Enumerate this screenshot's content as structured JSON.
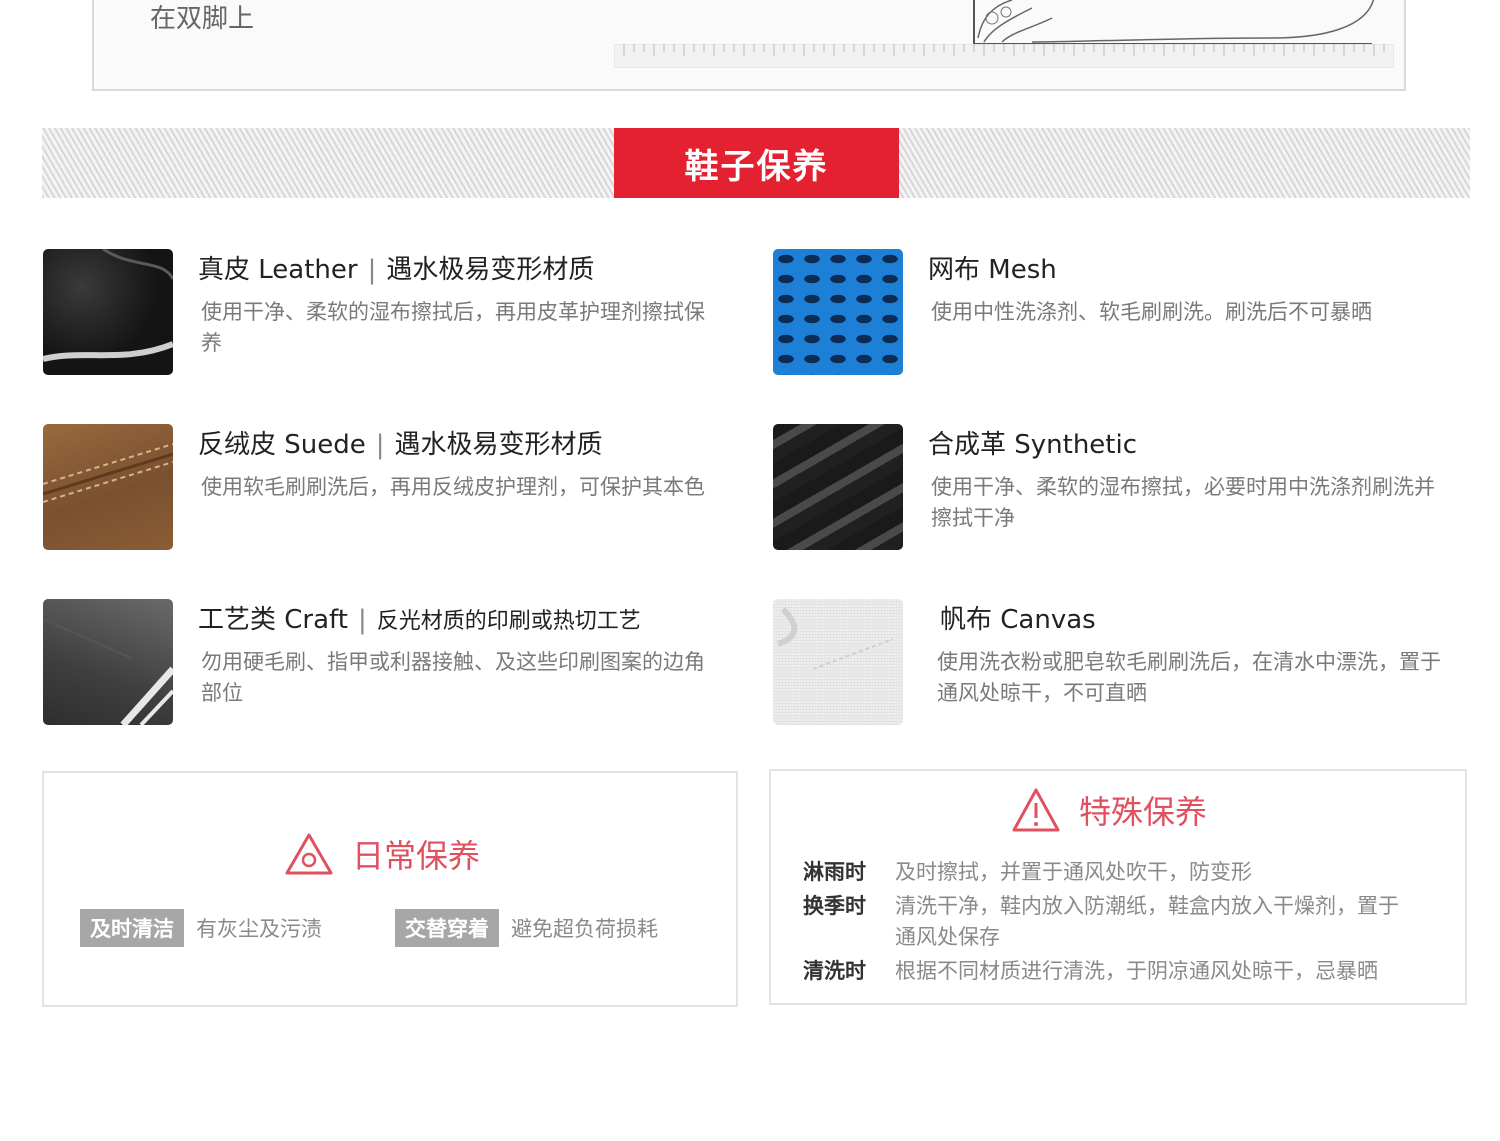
{
  "top_text": "在双脚上",
  "section_title": "鞋子保养",
  "materials": [
    {
      "name": "真皮 Leather",
      "note": "遇水极易变形材质",
      "desc": "使用干净、柔软的湿布擦拭后，再用皮革护理剂擦拭保养"
    },
    {
      "name": "网布 Mesh",
      "note": "",
      "desc": "使用中性洗涤剂、软毛刷刷洗。刷洗后不可暴晒"
    },
    {
      "name": "反绒皮 Suede",
      "note": "遇水极易变形材质",
      "desc": "使用软毛刷刷洗后，再用反绒皮护理剂，可保护其本色"
    },
    {
      "name": "合成革 Synthetic",
      "note": "",
      "desc": "使用干净、柔软的湿布擦拭，必要时用中洗涤剂刷洗并擦拭干净"
    },
    {
      "name": "工艺类 Craft",
      "note": "反光材质的印刷或热切工艺",
      "desc": "勿用硬毛刷、指甲或利器接触、及这些印刷图案的边角部位"
    },
    {
      "name": "帆布 Canvas",
      "note": "",
      "desc": "使用洗衣粉或肥皂软毛刷刷洗后，在清水中漂洗，置于通风处晾干，不可直晒"
    }
  ],
  "daily_care": {
    "title": "日常保养",
    "tags": [
      {
        "label": "及时清洁",
        "text": "有灰尘及污渍"
      },
      {
        "label": "交替穿着",
        "text": "避免超负荷损耗"
      }
    ]
  },
  "special_care": {
    "title": "特殊保养",
    "rows": [
      {
        "key": "淋雨时",
        "value": "及时擦拭，并置于通风处吹干，防变形"
      },
      {
        "key": "换季时",
        "value": "清洗干净，鞋内放入防潮纸，鞋盒内放入干燥剂，置于通风处保存"
      },
      {
        "key": "清洗时",
        "value": "根据不同材质进行清洗，于阴凉通风处晾干，忌暴晒"
      }
    ]
  },
  "colors": {
    "accent": "#e42131",
    "heading_pink": "#e0505f"
  }
}
